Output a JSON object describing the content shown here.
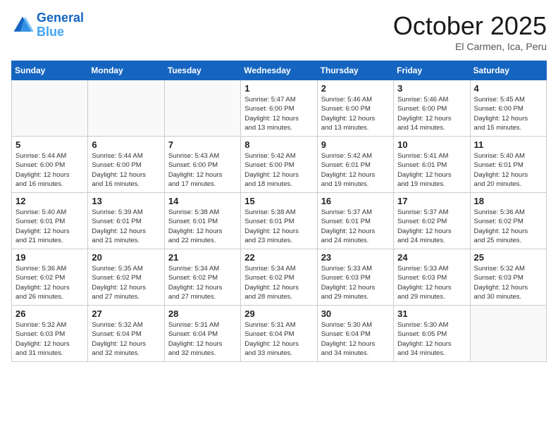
{
  "header": {
    "logo_line1": "General",
    "logo_line2": "Blue",
    "month": "October 2025",
    "location": "El Carmen, Ica, Peru"
  },
  "weekdays": [
    "Sunday",
    "Monday",
    "Tuesday",
    "Wednesday",
    "Thursday",
    "Friday",
    "Saturday"
  ],
  "weeks": [
    [
      {
        "day": "",
        "info": ""
      },
      {
        "day": "",
        "info": ""
      },
      {
        "day": "",
        "info": ""
      },
      {
        "day": "1",
        "info": "Sunrise: 5:47 AM\nSunset: 6:00 PM\nDaylight: 12 hours\nand 13 minutes."
      },
      {
        "day": "2",
        "info": "Sunrise: 5:46 AM\nSunset: 6:00 PM\nDaylight: 12 hours\nand 13 minutes."
      },
      {
        "day": "3",
        "info": "Sunrise: 5:46 AM\nSunset: 6:00 PM\nDaylight: 12 hours\nand 14 minutes."
      },
      {
        "day": "4",
        "info": "Sunrise: 5:45 AM\nSunset: 6:00 PM\nDaylight: 12 hours\nand 15 minutes."
      }
    ],
    [
      {
        "day": "5",
        "info": "Sunrise: 5:44 AM\nSunset: 6:00 PM\nDaylight: 12 hours\nand 16 minutes."
      },
      {
        "day": "6",
        "info": "Sunrise: 5:44 AM\nSunset: 6:00 PM\nDaylight: 12 hours\nand 16 minutes."
      },
      {
        "day": "7",
        "info": "Sunrise: 5:43 AM\nSunset: 6:00 PM\nDaylight: 12 hours\nand 17 minutes."
      },
      {
        "day": "8",
        "info": "Sunrise: 5:42 AM\nSunset: 6:00 PM\nDaylight: 12 hours\nand 18 minutes."
      },
      {
        "day": "9",
        "info": "Sunrise: 5:42 AM\nSunset: 6:01 PM\nDaylight: 12 hours\nand 19 minutes."
      },
      {
        "day": "10",
        "info": "Sunrise: 5:41 AM\nSunset: 6:01 PM\nDaylight: 12 hours\nand 19 minutes."
      },
      {
        "day": "11",
        "info": "Sunrise: 5:40 AM\nSunset: 6:01 PM\nDaylight: 12 hours\nand 20 minutes."
      }
    ],
    [
      {
        "day": "12",
        "info": "Sunrise: 5:40 AM\nSunset: 6:01 PM\nDaylight: 12 hours\nand 21 minutes."
      },
      {
        "day": "13",
        "info": "Sunrise: 5:39 AM\nSunset: 6:01 PM\nDaylight: 12 hours\nand 21 minutes."
      },
      {
        "day": "14",
        "info": "Sunrise: 5:38 AM\nSunset: 6:01 PM\nDaylight: 12 hours\nand 22 minutes."
      },
      {
        "day": "15",
        "info": "Sunrise: 5:38 AM\nSunset: 6:01 PM\nDaylight: 12 hours\nand 23 minutes."
      },
      {
        "day": "16",
        "info": "Sunrise: 5:37 AM\nSunset: 6:01 PM\nDaylight: 12 hours\nand 24 minutes."
      },
      {
        "day": "17",
        "info": "Sunrise: 5:37 AM\nSunset: 6:02 PM\nDaylight: 12 hours\nand 24 minutes."
      },
      {
        "day": "18",
        "info": "Sunrise: 5:36 AM\nSunset: 6:02 PM\nDaylight: 12 hours\nand 25 minutes."
      }
    ],
    [
      {
        "day": "19",
        "info": "Sunrise: 5:36 AM\nSunset: 6:02 PM\nDaylight: 12 hours\nand 26 minutes."
      },
      {
        "day": "20",
        "info": "Sunrise: 5:35 AM\nSunset: 6:02 PM\nDaylight: 12 hours\nand 27 minutes."
      },
      {
        "day": "21",
        "info": "Sunrise: 5:34 AM\nSunset: 6:02 PM\nDaylight: 12 hours\nand 27 minutes."
      },
      {
        "day": "22",
        "info": "Sunrise: 5:34 AM\nSunset: 6:02 PM\nDaylight: 12 hours\nand 28 minutes."
      },
      {
        "day": "23",
        "info": "Sunrise: 5:33 AM\nSunset: 6:03 PM\nDaylight: 12 hours\nand 29 minutes."
      },
      {
        "day": "24",
        "info": "Sunrise: 5:33 AM\nSunset: 6:03 PM\nDaylight: 12 hours\nand 29 minutes."
      },
      {
        "day": "25",
        "info": "Sunrise: 5:32 AM\nSunset: 6:03 PM\nDaylight: 12 hours\nand 30 minutes."
      }
    ],
    [
      {
        "day": "26",
        "info": "Sunrise: 5:32 AM\nSunset: 6:03 PM\nDaylight: 12 hours\nand 31 minutes."
      },
      {
        "day": "27",
        "info": "Sunrise: 5:32 AM\nSunset: 6:04 PM\nDaylight: 12 hours\nand 32 minutes."
      },
      {
        "day": "28",
        "info": "Sunrise: 5:31 AM\nSunset: 6:04 PM\nDaylight: 12 hours\nand 32 minutes."
      },
      {
        "day": "29",
        "info": "Sunrise: 5:31 AM\nSunset: 6:04 PM\nDaylight: 12 hours\nand 33 minutes."
      },
      {
        "day": "30",
        "info": "Sunrise: 5:30 AM\nSunset: 6:04 PM\nDaylight: 12 hours\nand 34 minutes."
      },
      {
        "day": "31",
        "info": "Sunrise: 5:30 AM\nSunset: 6:05 PM\nDaylight: 12 hours\nand 34 minutes."
      },
      {
        "day": "",
        "info": ""
      }
    ]
  ]
}
